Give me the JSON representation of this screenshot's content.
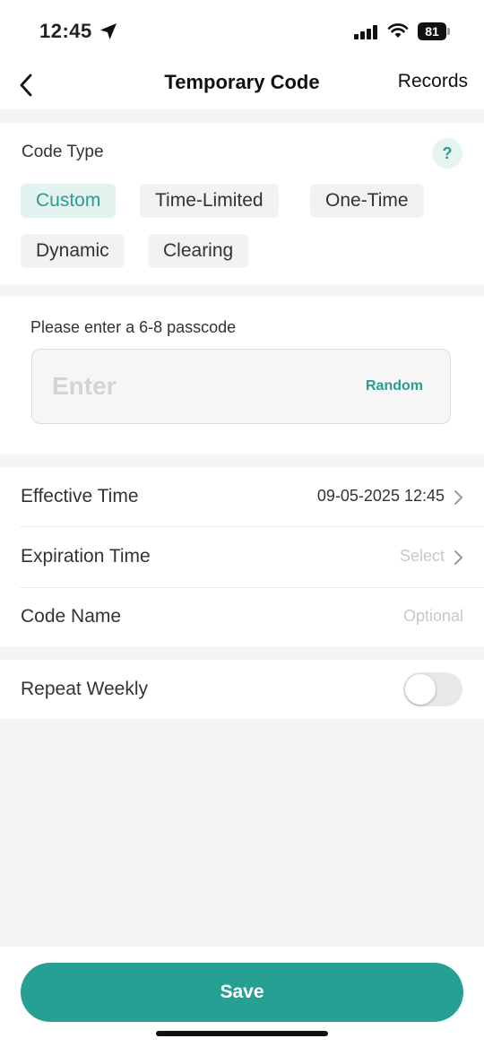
{
  "status_bar": {
    "time": "12:45",
    "battery": "81"
  },
  "nav": {
    "title": "Temporary Code",
    "records_label": "Records"
  },
  "code_type": {
    "label": "Code Type",
    "help": "?",
    "options": [
      "Custom",
      "Time-Limited",
      "One-Time",
      "Dynamic",
      "Clearing"
    ],
    "selected": "Custom"
  },
  "passcode": {
    "label": "Please enter a 6-8 passcode",
    "placeholder": "Enter",
    "value": "",
    "random_label": "Random"
  },
  "effective_time": {
    "label": "Effective Time",
    "value": "09-05-2025 12:45"
  },
  "expiration_time": {
    "label": "Expiration Time",
    "value": "Select"
  },
  "code_name": {
    "label": "Code Name",
    "placeholder": "Optional"
  },
  "repeat_weekly": {
    "label": "Repeat Weekly",
    "enabled": false
  },
  "save_label": "Save",
  "colors": {
    "accent": "#26a092",
    "chip_active_bg": "#e3f3ef",
    "background": "#f5f5f5"
  }
}
